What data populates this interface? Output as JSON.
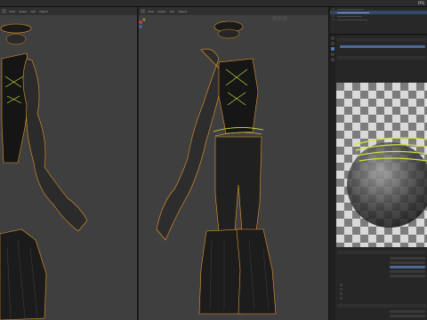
{
  "window": {
    "title": "",
    "fps_label": "FPS"
  },
  "viewport_left": {
    "menu": [
      "View",
      "Select",
      "Add",
      "Object"
    ]
  },
  "viewport_right": {
    "menu": [
      "View",
      "Select",
      "Add",
      "Object"
    ],
    "stats": []
  },
  "outliner": {
    "items": []
  },
  "properties": {
    "rows": [],
    "sections": []
  },
  "colors": {
    "viewport_bg": "#3f3f3f",
    "selection_outline": "#e8982a",
    "edit_curve": "#d7e63a",
    "panel_bg": "#262626",
    "accent": "#4f79b9"
  },
  "icons": [
    "view-axes-gizmo",
    "camera-icon",
    "hand-icon",
    "zoom-icon",
    "scene-icon",
    "material-icon",
    "render-icon"
  ]
}
